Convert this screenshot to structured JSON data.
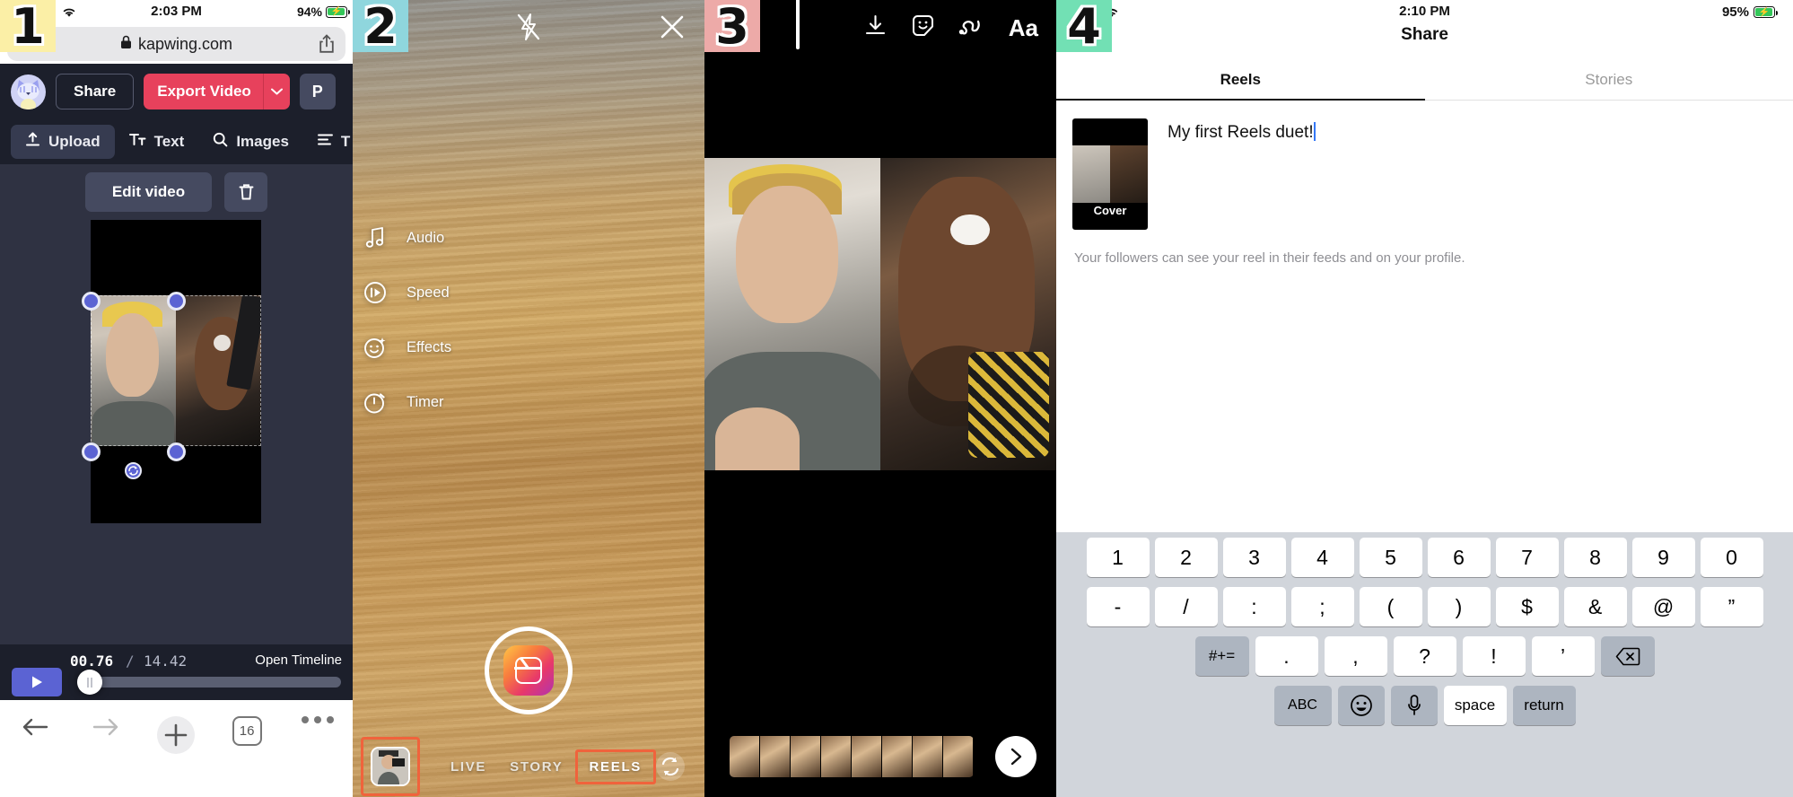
{
  "steps": [
    {
      "n": "1",
      "color": "#fbefa6"
    },
    {
      "n": "2",
      "color": "#8fd6dd"
    },
    {
      "n": "3",
      "color": "#edaaa8"
    },
    {
      "n": "4",
      "color": "#72e0b4"
    }
  ],
  "panel1": {
    "status": {
      "time": "2:03 PM",
      "battery": "94%",
      "wifi_icon": "wifi-icon",
      "battery_icon": "battery-charging-icon"
    },
    "browser": {
      "url": "kapwing.com",
      "lock_icon": "lock-icon",
      "share_icon": "share-out-icon"
    },
    "header": {
      "avatar_icon": "cat-avatar-icon",
      "share_label": "Share",
      "export_label": "Export Video",
      "export_caret_icon": "chevron-down-icon",
      "profile_label": "P"
    },
    "tabs": [
      {
        "label": "Upload",
        "icon": "upload-icon",
        "active": true
      },
      {
        "label": "Text",
        "icon": "text-format-icon",
        "active": false
      },
      {
        "label": "Images",
        "icon": "search-icon",
        "active": false
      },
      {
        "label": "T",
        "icon": "tracks-icon",
        "active": false
      }
    ],
    "subbar": {
      "edit_label": "Edit video",
      "delete_icon": "trash-icon"
    },
    "canvas": {
      "handle_icon": "resize-handle",
      "rotate_icon": "rotate-icon"
    },
    "timeline": {
      "current": "00.76",
      "separator": "/",
      "total": "14.42",
      "open_label": "Open Timeline",
      "play_icon": "play-icon",
      "scrub_icon": "scrubber-handle"
    },
    "safari": {
      "back_icon": "arrow-left-icon",
      "forward_icon": "arrow-right-icon",
      "new_icon": "plus-icon",
      "tab_count": "16",
      "more_icon": "ellipsis-icon"
    }
  },
  "panel2": {
    "top": {
      "flash_icon": "flash-off-icon",
      "close_icon": "close-icon"
    },
    "menu": [
      {
        "label": "Audio",
        "icon": "music-note-icon"
      },
      {
        "label": "Speed",
        "icon": "speed-icon"
      },
      {
        "label": "Effects",
        "icon": "effects-face-icon"
      },
      {
        "label": "Timer",
        "icon": "timer-icon"
      }
    ],
    "shutter": {
      "icon": "reels-shutter-icon"
    },
    "bottom": {
      "gallery_icon": "camera-roll-thumbnail",
      "modes": [
        {
          "label": "LIVE",
          "selected": false
        },
        {
          "label": "STORY",
          "selected": false
        },
        {
          "label": "REELS",
          "selected": true
        }
      ],
      "flip_icon": "flip-camera-icon"
    }
  },
  "panel3": {
    "top_icons": [
      {
        "name": "download-icon"
      },
      {
        "name": "sticker-icon"
      },
      {
        "name": "draw-icon"
      },
      {
        "name": "text-aa-icon",
        "label": "Aa"
      }
    ],
    "filmstrip": {
      "icon": "filmstrip-trimmer",
      "playhead_icon": "playhead-icon"
    },
    "next": {
      "icon": "chevron-right-icon"
    }
  },
  "panel4": {
    "status": {
      "time": "2:10 PM",
      "battery": "95%",
      "wifi_icon": "wifi-icon",
      "battery_icon": "battery-charging-icon"
    },
    "nav_title": "Share",
    "tabs": [
      {
        "label": "Reels",
        "active": true
      },
      {
        "label": "Stories",
        "active": false
      }
    ],
    "cover_label": "Cover",
    "caption": "My first Reels duet!",
    "hint": "Your followers can see your reel in their feeds and on your profile.",
    "keyboard": {
      "row1": [
        "1",
        "2",
        "3",
        "4",
        "5",
        "6",
        "7",
        "8",
        "9",
        "0"
      ],
      "row2": [
        "-",
        "/",
        ":",
        ";",
        "(",
        ")",
        "$",
        "&",
        "@",
        "”"
      ],
      "row3_symbols": "#+=",
      "row3": [
        ".",
        ",",
        "?",
        "!",
        "’"
      ],
      "delete_icon": "delete-key-icon",
      "abc_label": "ABC",
      "emoji_icon": "emoji-icon",
      "mic_icon": "microphone-icon",
      "space_label": "space",
      "return_label": "return"
    }
  }
}
